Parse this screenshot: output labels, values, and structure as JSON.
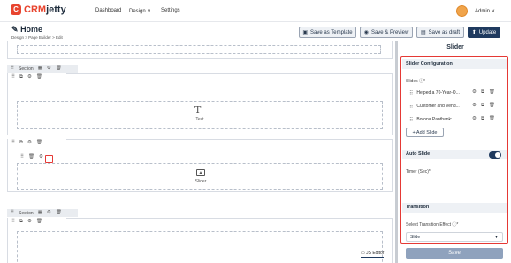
{
  "logo": {
    "mark": "C",
    "crm": "CRM",
    "jetty": "jetty"
  },
  "nav": [
    "Dashboard",
    "Design ∨",
    "Settings"
  ],
  "user": "Admin ∨",
  "page": {
    "title": "Home",
    "breadcrumb": "Design  >  Page Builder  >  Edit"
  },
  "toolbar": {
    "template": "Save as Template",
    "preview": "Save & Preview",
    "draft": "Save as draft",
    "update": "Update"
  },
  "canvas": {
    "section_label": "Section",
    "text_label": "Text",
    "slider_label": "Slider"
  },
  "panel": {
    "title": "Slider",
    "config": "Slider Configuration",
    "slides_label": "Slides ⓘ*",
    "slides": [
      "Helped a 70-Year-O...",
      "Customer and Vend...",
      "Borona Pantbank:..."
    ],
    "add": "+ Add Slide",
    "auto": "Auto Slide",
    "timer": "Timer (Sec)*",
    "transition": "Transition",
    "effect_label": "Select Transition Effect ⓘ*",
    "effect_value": "Slide",
    "save": "Save"
  },
  "js_editor": "JS Editor"
}
